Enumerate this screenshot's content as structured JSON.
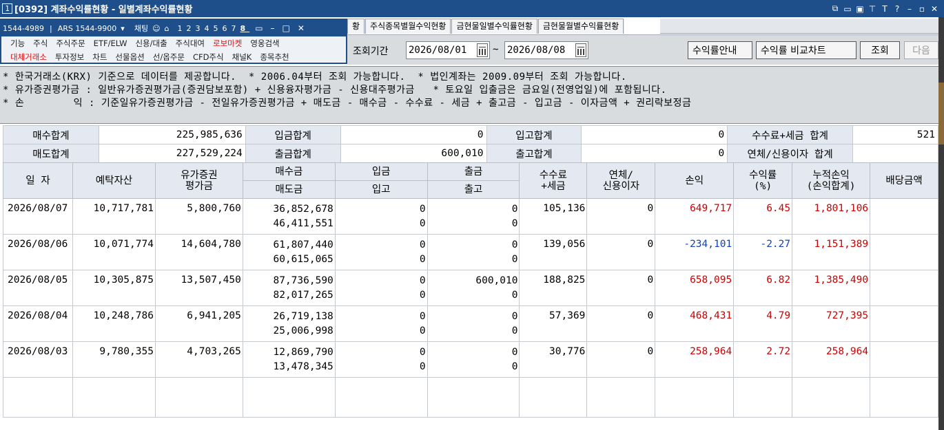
{
  "window": {
    "number": "1",
    "title": "[0392] 계좌수익률현황 - 일별계좌수익률현황",
    "controls": [
      "⧉",
      "▭",
      "▣",
      "⊤",
      "T",
      "?",
      "–",
      "▫",
      "✕"
    ]
  },
  "popup": {
    "phone": "1544-4989",
    "ars": "ARS 1544-9900",
    "chat": "채팅",
    "pages": [
      "1",
      "2",
      "3",
      "4",
      "5",
      "6",
      "7",
      "8"
    ],
    "selected_page": "8",
    "row1": [
      "기능",
      "주식",
      "주식주문",
      "ETF/ELW",
      "신용/대출",
      "주식대여",
      "로보마켓",
      "영웅검색"
    ],
    "row2": [
      "대체거래소",
      "투자정보",
      "차트",
      "선물옵션",
      "선/옵주문",
      "CFD주식",
      "채널K",
      "종목추천"
    ]
  },
  "tabs": [
    "황",
    "주식종목별월수익현황",
    "금현물일별수익률현황",
    "금현물월별수익률현황"
  ],
  "query": {
    "label": "조회기간",
    "from": "2026/08/01",
    "to": "2026/08/08",
    "tilde": "~",
    "btn_guide": "수익률안내",
    "btn_chart": "수익률 비교차트",
    "btn_query": "조회",
    "btn_next": "다음"
  },
  "notice": [
    "* 한국거래소(KRX) 기준으로 데이터를 제공합니다.  * 2006.04부터 조회 가능합니다.  * 법인계좌는 2009.09부터 조회 가능합니다.",
    "* 유가증권평가금 : 일반유가증권평가금(증권담보포함) + 신용융자평가금 - 신용대주평가금   * 토요일 입출금은 금요일(전영업일)에 포함됩니다.",
    "* 손        익 : 기준일유가증권평가금 - 전일유가증권평가금 + 매도금 - 매수금 - 수수료 - 세금 + 출고금 - 입고금 - 이자금액 + 권리락보정금"
  ],
  "summary": {
    "buy_total_label": "매수합계",
    "buy_total": "225,985,636",
    "dep_total_label": "입금합계",
    "dep_total": "0",
    "in_total_label": "입고합계",
    "in_total": "0",
    "fee_tax_label": "수수료+세금 합계",
    "fee_tax": "521",
    "sell_total_label": "매도합계",
    "sell_total": "227,529,224",
    "wd_total_label": "출금합계",
    "wd_total": "600,010",
    "out_total_label": "출고합계",
    "out_total": "0",
    "interest_label": "연체/신용이자 합계",
    "interest": ""
  },
  "columns": {
    "date": "일 자",
    "deposit_asset": "예탁자산",
    "securities_1": "유가증권",
    "securities_2": "평가금",
    "buy": "매수금",
    "sell": "매도금",
    "deposit": "입금",
    "in": "입고",
    "withdraw": "출금",
    "out": "출고",
    "fee_1": "수수료",
    "fee_2": "+세금",
    "late_1": "연체/",
    "late_2": "신용이자",
    "pnl": "손익",
    "rate_1": "수익률",
    "rate_2": "(%)",
    "cum_1": "누적손익",
    "cum_2": "(손익합계)",
    "dividend": "배당금액"
  },
  "rows": [
    {
      "date": "2026/08/07",
      "asset": "10,717,781",
      "sec": "5,800,760",
      "buy": "36,852,678",
      "sell": "46,411,551",
      "dep": "0",
      "in": "0",
      "wd": "0",
      "out": "0",
      "fee": "105,136",
      "late": "0",
      "pnl": "649,717",
      "rate": "6.45",
      "cum": "1,801,106",
      "div": "",
      "sign": "pos"
    },
    {
      "date": "2026/08/06",
      "asset": "10,071,774",
      "sec": "14,604,780",
      "buy": "61,807,440",
      "sell": "60,615,065",
      "dep": "0",
      "in": "0",
      "wd": "0",
      "out": "0",
      "fee": "139,056",
      "late": "0",
      "pnl": "-234,101",
      "rate": "-2.27",
      "cum": "1,151,389",
      "div": "",
      "sign": "neg"
    },
    {
      "date": "2026/08/05",
      "asset": "10,305,875",
      "sec": "13,507,450",
      "buy": "87,736,590",
      "sell": "82,017,265",
      "dep": "0",
      "in": "0",
      "wd": "600,010",
      "out": "0",
      "fee": "188,825",
      "late": "0",
      "pnl": "658,095",
      "rate": "6.82",
      "cum": "1,385,490",
      "div": "",
      "sign": "pos"
    },
    {
      "date": "2026/08/04",
      "asset": "10,248,786",
      "sec": "6,941,205",
      "buy": "26,719,138",
      "sell": "25,006,998",
      "dep": "0",
      "in": "0",
      "wd": "0",
      "out": "0",
      "fee": "57,369",
      "late": "0",
      "pnl": "468,431",
      "rate": "4.79",
      "cum": "727,395",
      "div": "",
      "sign": "pos"
    },
    {
      "date": "2026/08/03",
      "asset": "9,780,355",
      "sec": "4,703,265",
      "buy": "12,869,790",
      "sell": "13,478,345",
      "dep": "0",
      "in": "0",
      "wd": "0",
      "out": "0",
      "fee": "30,776",
      "late": "0",
      "pnl": "258,964",
      "rate": "2.72",
      "cum": "258,964",
      "div": "",
      "sign": "pos"
    }
  ],
  "colors": {
    "title_bg": "#1f4f8a",
    "header_bg": "#e4e9f1",
    "positive": "#c00000",
    "negative": "#1740b0"
  }
}
